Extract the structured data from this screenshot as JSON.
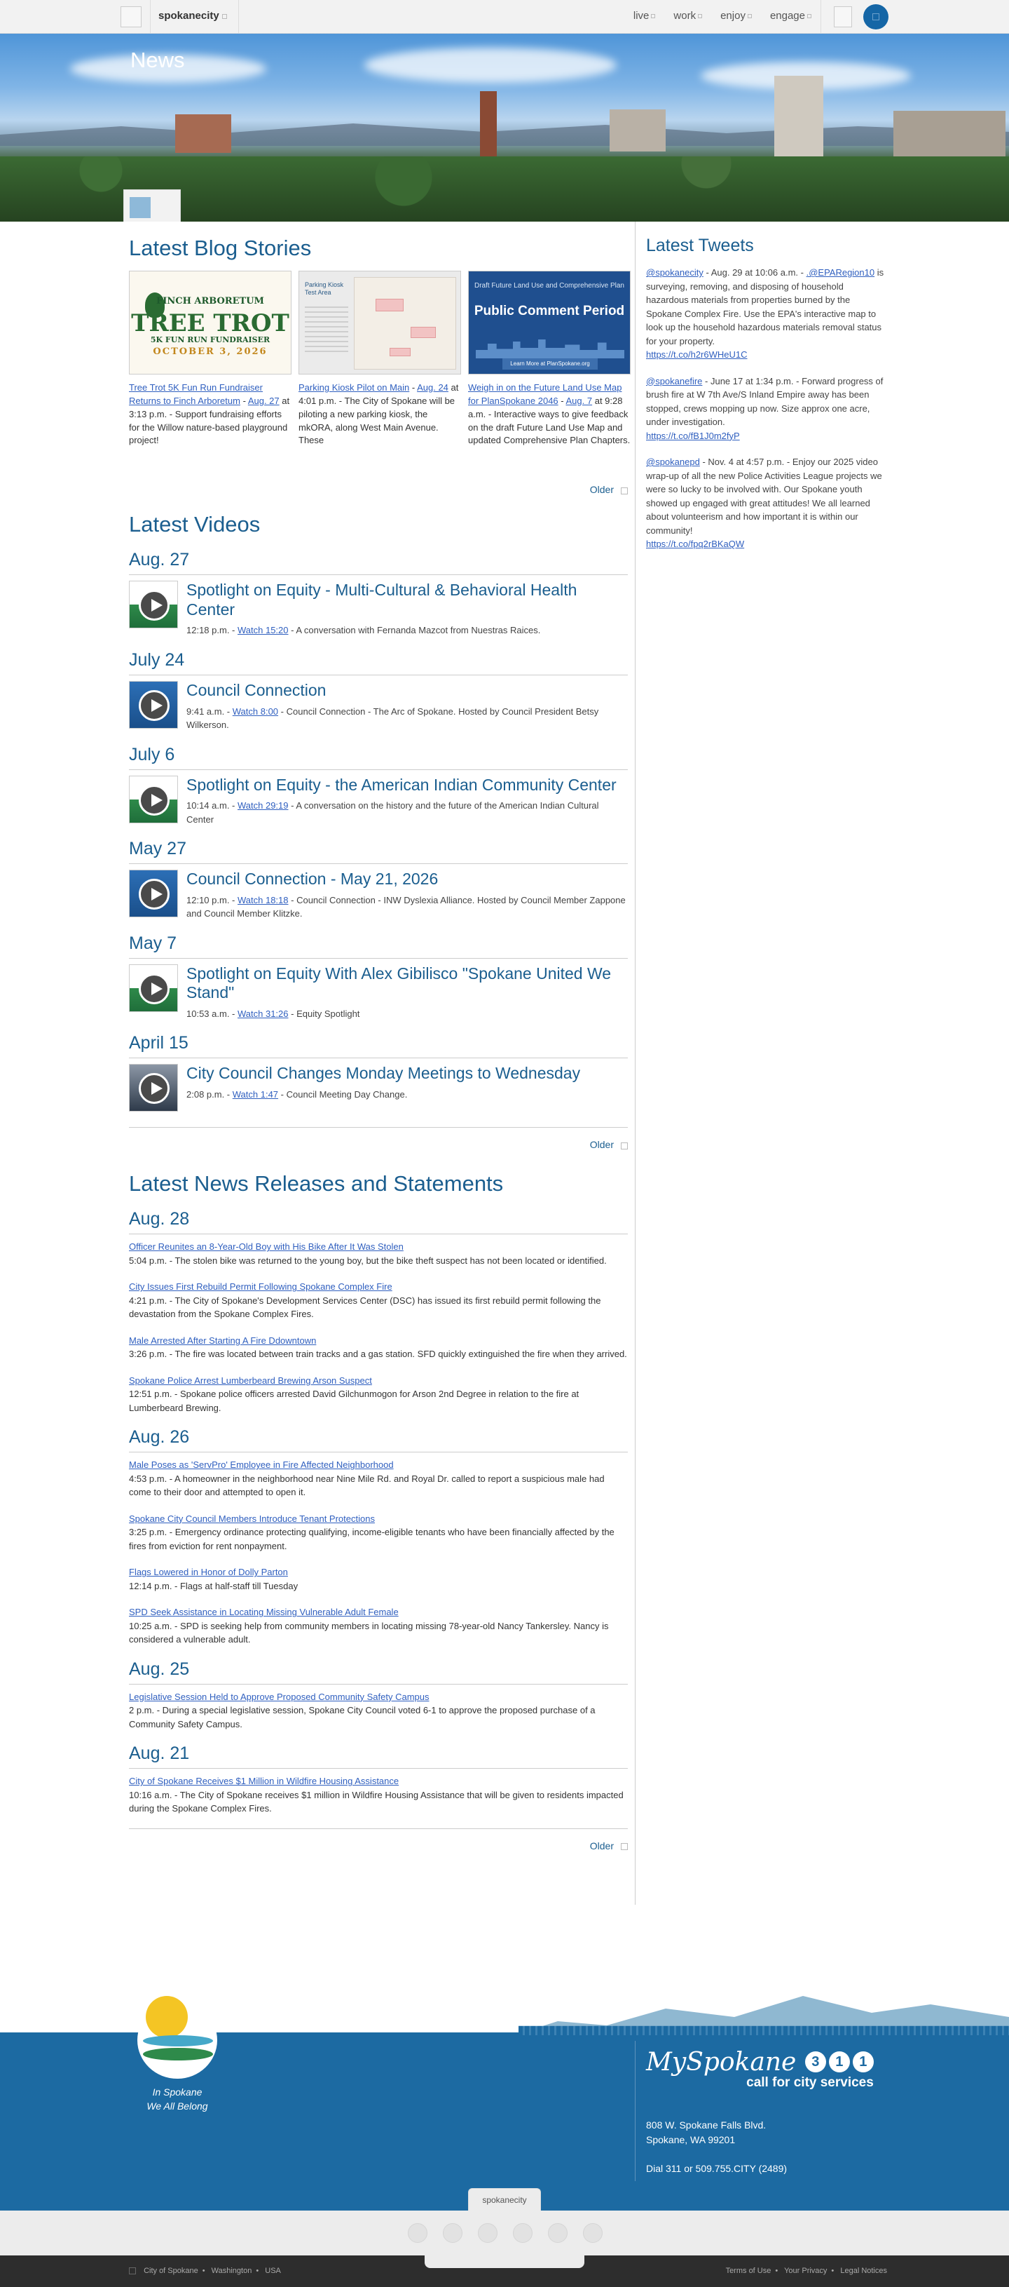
{
  "topnav": {
    "brand": "spokanecity",
    "links": [
      "live",
      "work",
      "enjoy",
      "engage"
    ]
  },
  "hero": {
    "title": "News"
  },
  "blog": {
    "heading": "Latest Blog Stories",
    "cards": [
      {
        "img": {
          "l1": "FINCH ARBORETUM",
          "l2": "TREE TROT",
          "l3": "5K FUN RUN FUNDRAISER",
          "l4": "OCTOBER 3, 2026"
        },
        "title": "Tree Trot 5K Fun Run Fundraiser Returns to Finch Arboretum",
        "date": "Aug. 27",
        "text": "at 3:13 p.m. - Support fundraising efforts for the Willow nature-based playground project!"
      },
      {
        "img": {
          "l1": "Parking Kiosk Test Area"
        },
        "title": "Parking Kiosk Pilot on Main",
        "date": "Aug. 24",
        "text": "at 4:01 p.m. - The City of Spokane will be piloting a new parking kiosk, the mkORA, along West Main Avenue. These"
      },
      {
        "img": {
          "l1": "Draft Future Land Use and Comprehensive Plan",
          "l2": "Public Comment Period",
          "l3": "Learn More at PlanSpokane.org"
        },
        "title": "Weigh in on the Future Land Use Map for PlanSpokane 2046",
        "date": "Aug. 7",
        "text": "at 9:28 a.m. - Interactive ways to give feedback on the draft Future Land Use Map and updated Comprehensive Plan Chapters."
      }
    ],
    "older": "Older"
  },
  "videos": {
    "heading": "Latest Videos",
    "groups": [
      {
        "date": "Aug. 27",
        "title": "Spotlight on Equity - Multi-Cultural & Behavioral Health Center",
        "time": "12:18 p.m. -",
        "watch": "Watch 15:20",
        "desc": "- A conversation with Fernanda Mazcot from Nuestras Raices."
      },
      {
        "date": "July 24",
        "title": "Council Connection",
        "time": "9:41 a.m. -",
        "watch": "Watch 8:00",
        "desc": "- Council Connection - The Arc of Spokane. Hosted by Council President Betsy Wilkerson."
      },
      {
        "date": "July 6",
        "title": "Spotlight on Equity - the American Indian Community Center",
        "time": "10:14 a.m. -",
        "watch": "Watch 29:19",
        "desc": "- A conversation on the history and the future of the American Indian Cultural Center"
      },
      {
        "date": "May 27",
        "title": "Council Connection - May 21, 2026",
        "time": "12:10 p.m. -",
        "watch": "Watch 18:18",
        "desc": "- Council Connection - INW Dyslexia Alliance. Hosted by Council Member Zappone and Council Member Klitzke."
      },
      {
        "date": "May 7",
        "title": "Spotlight on Equity With Alex Gibilisco \"Spokane United We Stand\"",
        "time": "10:53 a.m. -",
        "watch": "Watch 31:26",
        "desc": "- Equity Spotlight"
      },
      {
        "date": "April 15",
        "title": "City Council Changes Monday Meetings to Wednesday",
        "time": "2:08 p.m. -",
        "watch": "Watch 1:47",
        "desc": "- Council Meeting Day Change."
      }
    ],
    "older": "Older"
  },
  "news": {
    "heading": "Latest News Releases and Statements",
    "groups": [
      {
        "date": "Aug. 28",
        "items": [
          {
            "title": "Officer Reunites an 8-Year-Old Boy with His Bike After It Was Stolen",
            "text": "5:04 p.m. - The stolen bike was returned to the young boy, but the bike theft suspect has not been located or identified."
          },
          {
            "title": "City Issues First Rebuild Permit Following Spokane Complex Fire",
            "text": "4:21 p.m. - The City of Spokane's Development Services Center (DSC) has issued its first rebuild permit following the devastation from the Spokane Complex Fires."
          },
          {
            "title": "Male Arrested After Starting A Fire Ddowntown",
            "text": "3:26 p.m. - The fire was located between train tracks and a gas station. SFD quickly extinguished the fire when they arrived."
          },
          {
            "title": "Spokane Police Arrest Lumberbeard Brewing Arson Suspect",
            "text": "12:51 p.m. - Spokane police officers arrested David Gilchunmogon for Arson 2nd Degree in relation to the fire at Lumberbeard Brewing."
          }
        ]
      },
      {
        "date": "Aug. 26",
        "items": [
          {
            "title": "Male Poses as 'ServPro' Employee in Fire Affected Neighborhood",
            "text": "4:53 p.m. - A homeowner in the neighborhood near Nine Mile Rd. and Royal Dr. called to report a suspicious male had come to their door and attempted to open it."
          },
          {
            "title": "Spokane City Council Members Introduce Tenant Protections",
            "text": "3:25 p.m. - Emergency ordinance protecting qualifying, income-eligible tenants who have been financially affected by the fires from eviction for rent nonpayment."
          },
          {
            "title": "Flags Lowered in Honor of Dolly Parton",
            "text": "12:14 p.m. - Flags at half-staff till Tuesday"
          },
          {
            "title": "SPD Seek Assistance in Locating Missing Vulnerable Adult Female",
            "text": "10:25 a.m. - SPD is seeking help from community members in locating missing 78-year-old Nancy Tankersley. Nancy is considered a vulnerable adult."
          }
        ]
      },
      {
        "date": "Aug. 25",
        "items": [
          {
            "title": "Legislative Session Held to Approve Proposed Community Safety Campus",
            "text": "2 p.m. - During a special legislative session, Spokane City Council voted 6-1 to approve the proposed purchase of a Community Safety Campus."
          }
        ]
      },
      {
        "date": "Aug. 21",
        "items": [
          {
            "title": "City of Spokane Receives $1 Million in Wildfire Housing Assistance",
            "text": "10:16 a.m. - The City of Spokane receives $1 million in Wildfire Housing Assistance that will be given to residents impacted during the Spokane Complex Fires."
          }
        ]
      }
    ],
    "older": "Older"
  },
  "tweets": {
    "heading": "Latest Tweets",
    "items": [
      {
        "handle": "@spokanecity",
        "meta": "- Aug. 29 at 10:06 a.m. -",
        "mention": ".@EPARegion10",
        "text": "is surveying, removing, and disposing of household hazardous materials from properties burned by the Spokane Complex Fire. Use the EPA's interactive map to look up the household hazardous materials removal status for your property.",
        "link": "https://t.co/h2r6WHeU1C"
      },
      {
        "handle": "@spokanefire",
        "meta": "- June 17 at 1:34 p.m. -",
        "mention": "",
        "text": "Forward progress of brush fire at W 7th Ave/S Inland Empire away has been stopped, crews mopping up now. Size approx one acre, under investigation.",
        "link": "https://t.co/fB1J0m2fyP"
      },
      {
        "handle": "@spokanepd",
        "meta": "- Nov. 4 at 4:57 p.m. -",
        "mention": "",
        "text": "Enjoy our 2025 video wrap-up of all the new Police Activities League projects we were so lucky to be involved with. Our Spokane youth showed up engaged with great attitudes! We all learned about volunteerism and how important it is within our community!",
        "link": "https://t.co/fpq2rBKaQW"
      }
    ]
  },
  "footer": {
    "tagline1": "In Spokane",
    "tagline2": "We All Belong",
    "my": "MySpokane",
    "digits": [
      "3",
      "1",
      "1"
    ],
    "cfs": "call for city services",
    "addr1": "808 W. Spokane Falls Blvd.",
    "addr2": "Spokane, WA 99201",
    "dial": "Dial 311 or 509.755.CITY (2489)",
    "tab": "spokanecity",
    "bottom_left": [
      "City of Spokane",
      "Washington",
      "USA"
    ],
    "bottom_right": [
      "Terms of Use",
      "Your Privacy",
      "Legal Notices"
    ]
  },
  "colors": {
    "accent": "#1b5e8f",
    "link": "#2f5fbf",
    "footer": "#1c6aa2"
  }
}
